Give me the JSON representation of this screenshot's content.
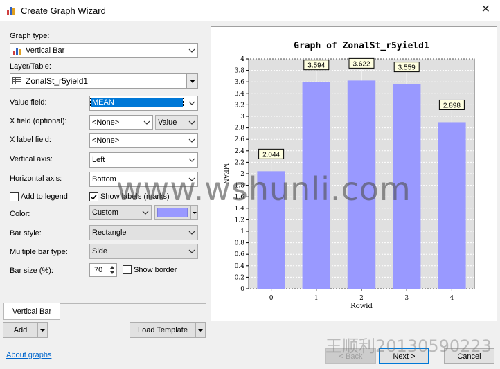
{
  "window": {
    "title": "Create Graph Wizard",
    "close_glyph": "✕"
  },
  "form": {
    "graph_type_label": "Graph type:",
    "graph_type_value": "Vertical Bar",
    "layer_label": "Layer/Table:",
    "layer_value": "ZonalSt_r5yield1",
    "value_field_label": "Value field:",
    "value_field_value": "MEAN",
    "x_field_label": "X field (optional):",
    "x_field_value": "<None>",
    "x_field_sort": "Value",
    "x_label_field_label": "X label field:",
    "x_label_field_value": "<None>",
    "vertical_axis_label": "Vertical axis:",
    "vertical_axis_value": "Left",
    "horizontal_axis_label": "Horizontal axis:",
    "horizontal_axis_value": "Bottom",
    "add_to_legend_label": "Add to legend",
    "add_to_legend_checked": false,
    "show_labels_label": "Show labels (marks)",
    "show_labels_checked": true,
    "color_label": "Color:",
    "color_value": "Custom",
    "color_swatch": "#9999ff",
    "bar_style_label": "Bar style:",
    "bar_style_value": "Rectangle",
    "multiple_bar_label": "Multiple bar type:",
    "multiple_bar_value": "Side",
    "bar_size_label": "Bar size (%):",
    "bar_size_value": "70",
    "show_border_label": "Show border",
    "show_border_checked": false
  },
  "tabs": [
    {
      "label": "Vertical Bar"
    }
  ],
  "buttons": {
    "add": "Add",
    "load_template": "Load Template",
    "back": "< Back",
    "next": "Next >",
    "cancel": "Cancel"
  },
  "links": {
    "about": "About graphs"
  },
  "watermark": {
    "main": "www.wshunli.com",
    "corner": "王顺利20130590223"
  },
  "colors": {
    "bar": "#9999ff",
    "plot_bg": "#e0e0e0",
    "accent": "#0078d7"
  },
  "chart_data": {
    "type": "bar",
    "title": "Graph of ZonalSt_r5yield1",
    "xlabel": "Rowid",
    "ylabel": "MEAN",
    "categories": [
      "0",
      "1",
      "2",
      "3",
      "4"
    ],
    "values": [
      2.044,
      3.594,
      3.622,
      3.559,
      2.898
    ],
    "data_labels": [
      "2.044",
      "3.594",
      "3.622",
      "3.559",
      "2.898"
    ],
    "ylim": [
      0,
      4
    ],
    "yticks": [
      "0",
      "0.2",
      "0.4",
      "0.6",
      "0.8",
      "1",
      "1.2",
      "1.4",
      "1.6",
      "1.8",
      "2",
      "2.2",
      "2.4",
      "2.6",
      "2.8",
      "3",
      "3.2",
      "3.4",
      "3.6",
      "3.8",
      "4"
    ],
    "grid": true,
    "legend": "none"
  }
}
